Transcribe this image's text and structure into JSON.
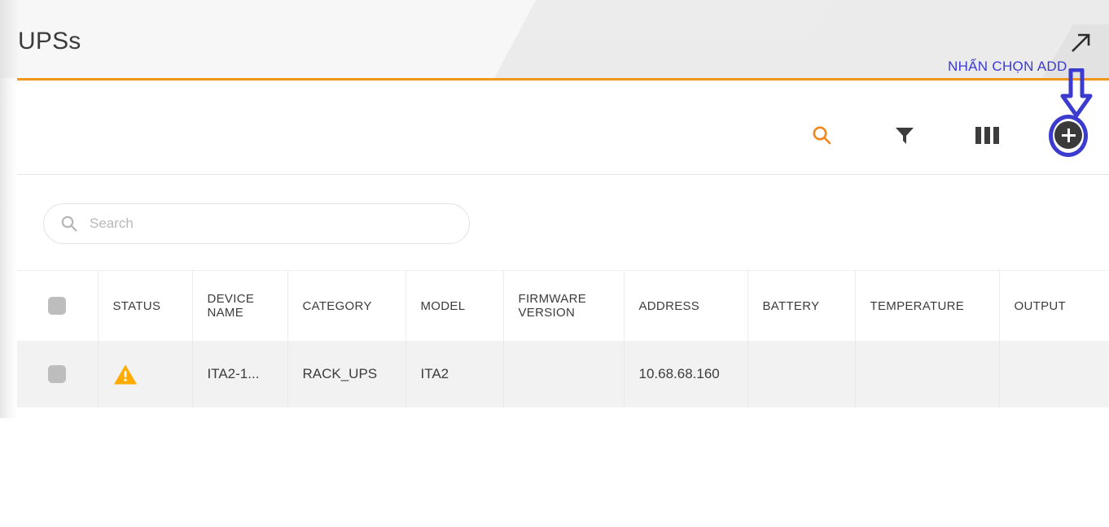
{
  "header": {
    "title": "UPSs",
    "expand_icon": "open-in-new-arrow-icon"
  },
  "annotation": {
    "text": "NHẤN CHỌN ADD",
    "color": "#3b3bd0",
    "arrow": "down-block-arrow",
    "highlight": "ellipse-around-add-button"
  },
  "toolbar": {
    "accent_color": "#f0971a",
    "items": [
      {
        "name": "search",
        "icon": "search-icon",
        "color": "#f0871a"
      },
      {
        "name": "filter",
        "icon": "filter-funnel-icon",
        "color": "#3c3c3c"
      },
      {
        "name": "columns",
        "icon": "columns-icon",
        "color": "#3c3c3c"
      },
      {
        "name": "add",
        "icon": "plus-icon",
        "color": "#ffffff",
        "background": "#3a3a3a"
      }
    ]
  },
  "search": {
    "placeholder": "Search",
    "value": "",
    "icon": "search-icon"
  },
  "table": {
    "columns": [
      "",
      "STATUS",
      "DEVICE NAME",
      "CATEGORY",
      "MODEL",
      "FIRMWARE VERSION",
      "ADDRESS",
      "BATTERY",
      "TEMPERATURE",
      "OUTPUT"
    ],
    "rows": [
      {
        "selected": false,
        "status": "warning",
        "device_name": "ITA2-1...",
        "category": "RACK_UPS",
        "model": "ITA2",
        "firmware_version": "",
        "address": "10.68.68.160",
        "battery": "",
        "temperature": "",
        "output": ""
      }
    ]
  }
}
